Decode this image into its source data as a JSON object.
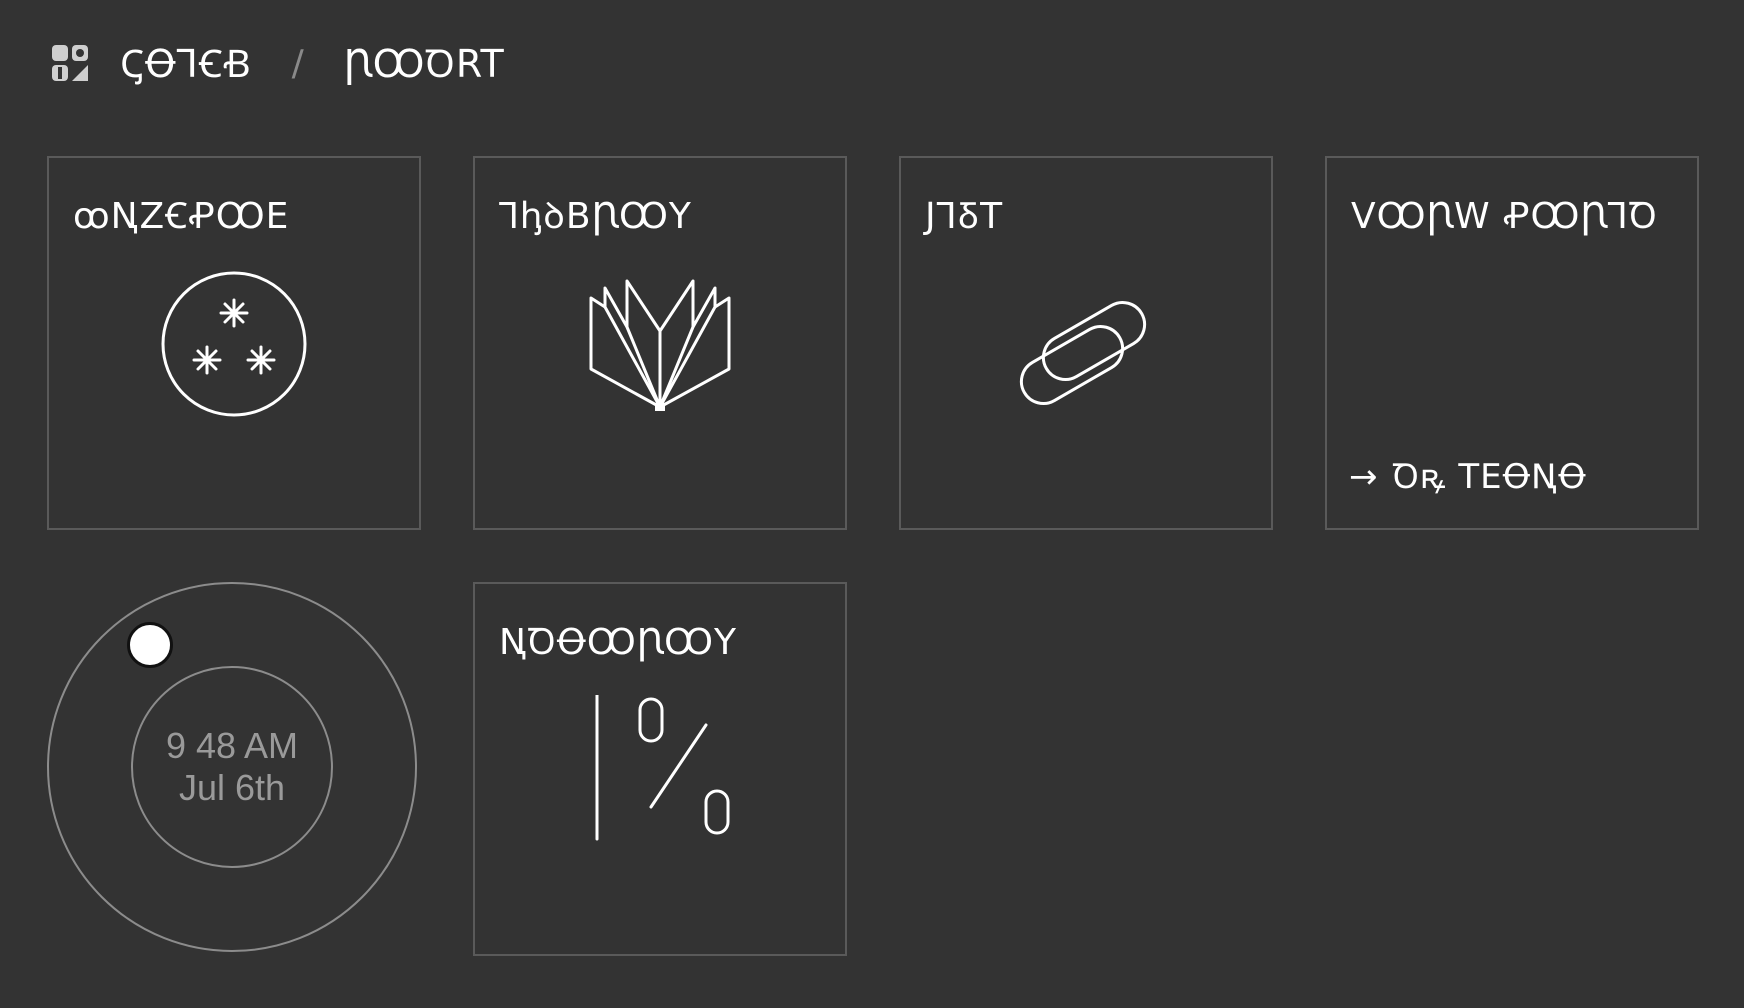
{
  "breadcrumb": {
    "root": "ꟄꝊꞀꞒꞖ",
    "separator": "/",
    "current": "ꞂꝎꝹRT"
  },
  "tiles": [
    {
      "id": "t1",
      "title": "ꝏꞐZꞒꝒꝎE",
      "icon": "three-stars-circle-icon"
    },
    {
      "id": "t2",
      "title": "ꞀꞕꝺBꞂꝎY",
      "icon": "open-book-icon"
    },
    {
      "id": "t3",
      "title": "JꞀꝽT",
      "icon": "chain-link-icon"
    },
    {
      "id": "t4",
      "title": "VꝎꞂW ꝒꝎꞂꞀꝹ",
      "footer": "Ꝺꝶ TEꝊꞐꝊ",
      "footer_icon": "arrow-right-icon"
    },
    {
      "id": "t6",
      "title": "ꞐꝹꝊꝎꞂꝎY",
      "icon": "percent-icon"
    }
  ],
  "clock": {
    "time": "9 48 AM",
    "date": "Jul 6th"
  },
  "colors": {
    "background": "#333333",
    "tile_border": "#5a5a5a",
    "foreground": "#ffffff",
    "muted": "#9a9a9a"
  }
}
